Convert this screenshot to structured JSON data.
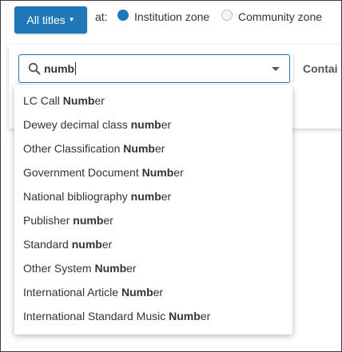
{
  "search_scope": {
    "button_label": "All titles",
    "at_label": "at:",
    "zones": [
      {
        "label": "Institution zone",
        "selected": true
      },
      {
        "label": "Community zone",
        "selected": false
      }
    ]
  },
  "search": {
    "query": "numb",
    "operator_label": "Contai"
  },
  "suggestions": [
    {
      "prefix": "LC Call ",
      "match": "Numb",
      "suffix": "er"
    },
    {
      "prefix": "Dewey decimal class ",
      "match": "numb",
      "suffix": "er"
    },
    {
      "prefix": "Other Classification ",
      "match": "Numb",
      "suffix": "er"
    },
    {
      "prefix": "Government Document ",
      "match": "Numb",
      "suffix": "er"
    },
    {
      "prefix": "National bibliography ",
      "match": "numb",
      "suffix": "er"
    },
    {
      "prefix": "Publisher ",
      "match": "numb",
      "suffix": "er"
    },
    {
      "prefix": "Standard ",
      "match": "numb",
      "suffix": "er"
    },
    {
      "prefix": "Other System ",
      "match": "Numb",
      "suffix": "er"
    },
    {
      "prefix": "International Article ",
      "match": "Numb",
      "suffix": "er"
    },
    {
      "prefix": "International Standard Music ",
      "match": "Numb",
      "suffix": "er"
    }
  ],
  "colors": {
    "accent": "#1f77b8"
  }
}
